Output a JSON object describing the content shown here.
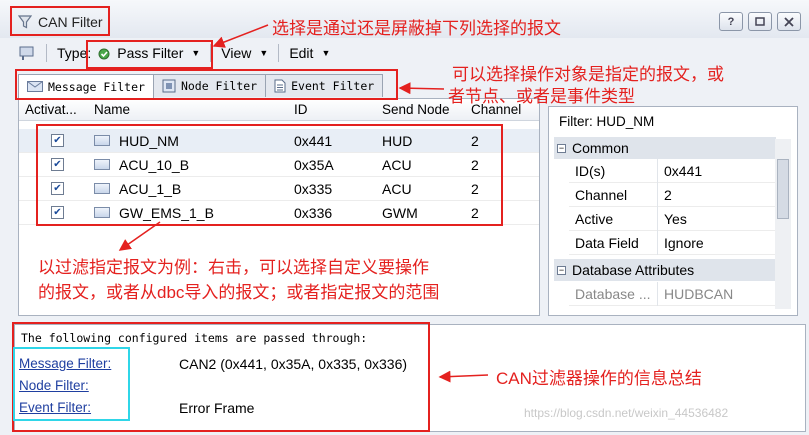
{
  "window": {
    "title": "CAN Filter"
  },
  "toolbar": {
    "type_label": "Type:",
    "type_value": "Pass Filter",
    "view_label": "View",
    "edit_label": "Edit"
  },
  "tabs": [
    {
      "label": "Message Filter",
      "active": true
    },
    {
      "label": "Node Filter",
      "active": false
    },
    {
      "label": "Event Filter",
      "active": false
    }
  ],
  "grid": {
    "columns": [
      "Activat...",
      "Name",
      "ID",
      "Send Node",
      "Channel"
    ],
    "rows": [
      {
        "active": true,
        "name": "HUD_NM",
        "id": "0x441",
        "send_node": "HUD",
        "channel": "2"
      },
      {
        "active": true,
        "name": "ACU_10_B",
        "id": "0x35A",
        "send_node": "ACU",
        "channel": "2"
      },
      {
        "active": true,
        "name": "ACU_1_B",
        "id": "0x335",
        "send_node": "ACU",
        "channel": "2"
      },
      {
        "active": true,
        "name": "GW_EMS_1_B",
        "id": "0x336",
        "send_node": "GWM",
        "channel": "2"
      }
    ]
  },
  "properties": {
    "title": "Filter:  HUD_NM",
    "common_label": "Common",
    "items": [
      {
        "key": "ID(s)",
        "value": "0x441"
      },
      {
        "key": "Channel",
        "value": "2"
      },
      {
        "key": "Active",
        "value": "Yes"
      },
      {
        "key": "Data Field",
        "value": "Ignore"
      }
    ],
    "db_label": "Database Attributes",
    "db_items": [
      {
        "key": "Database ...",
        "value": "HUDBCAN"
      }
    ]
  },
  "summary": {
    "header": "The following configured items are passed through:",
    "rows": [
      {
        "link": "Message Filter:",
        "value": "CAN2 (0x441, 0x35A, 0x335, 0x336)"
      },
      {
        "link": "Node Filter:",
        "value": ""
      },
      {
        "link": "Event Filter:",
        "value": "Error Frame"
      }
    ]
  },
  "annotations": {
    "note1": "选择是通过还是屏蔽掉下列选择的报文",
    "note2a": "可以选择操作对象是指定的报文，或",
    "note2b": "者节点、或者是事件类型",
    "note3a": "以过滤指定报文为例：右击，可以选择自定义要操作",
    "note3b": "的报文，或者从dbc导入的报文；或者指定报文的范围",
    "note4": "CAN过滤器操作的信息总结",
    "watermark": "https://blog.csdn.net/weixin_44536482"
  },
  "colors": {
    "annotation": "#e4211f",
    "highlight": "#2fd6e8",
    "link": "#1f3fa0"
  }
}
